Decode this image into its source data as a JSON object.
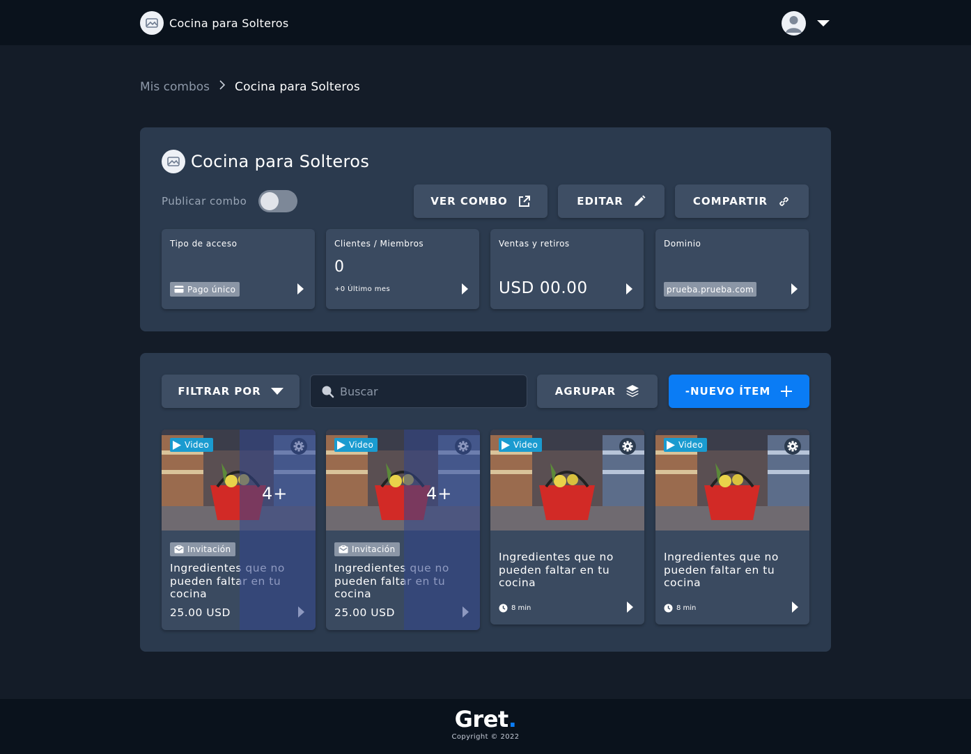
{
  "header": {
    "brand_name": "Cocina para Solteros",
    "logo_icon": "image-icon",
    "avatar_icon": "user-icon"
  },
  "breadcrumb": {
    "parent": "Mis combos",
    "current": "Cocina para Solteros"
  },
  "combo": {
    "title": "Cocina para Solteros",
    "publish_label": "Publicar combo",
    "publish_on": false,
    "actions": {
      "view": "VER COMBO",
      "edit": "EDITAR",
      "share": "COMPARTIR"
    }
  },
  "stats": {
    "access": {
      "label": "Tipo de acceso",
      "tag": "Pago único"
    },
    "clients": {
      "label": "Clientes / Miembros",
      "value": "0",
      "sub": "+0 Último mes"
    },
    "sales": {
      "label": "Ventas y retiros",
      "value": "USD 00.00"
    },
    "domain": {
      "label": "Dominio",
      "value": "prueba.prueba.com"
    }
  },
  "toolbar": {
    "filter": "FILTRAR POR",
    "search_placeholder": "Buscar",
    "group": "AGRUPAR",
    "new_item": "-NUEVO ÍTEM"
  },
  "items": [
    {
      "badge": "Video",
      "more": "4+",
      "tag": "Invitación",
      "title": "Ingredientes que no pueden faltar en tu cocina",
      "price": "25.00 USD"
    },
    {
      "badge": "Video",
      "more": "4+",
      "tag": "Invitación",
      "title": "Ingredientes que no pueden faltar en tu cocina",
      "price": "25.00 USD"
    },
    {
      "badge": "Video",
      "title": "Ingredientes que no pueden faltar en tu cocina",
      "duration": "8 min"
    },
    {
      "badge": "Video",
      "title": "Ingredientes que no pueden faltar en tu cocina",
      "duration": "8 min"
    }
  ],
  "footer": {
    "logo_text": "Gret",
    "logo_dot": ".",
    "copyright": "Copyright © 2022"
  },
  "colors": {
    "page_bg": "#141c28",
    "bar_bg": "#0a121c",
    "panel_bg": "#2b3a4e",
    "card_bg": "#3a4a60",
    "accent": "#0a7cf5",
    "video_badge": "#1a9bd0"
  }
}
